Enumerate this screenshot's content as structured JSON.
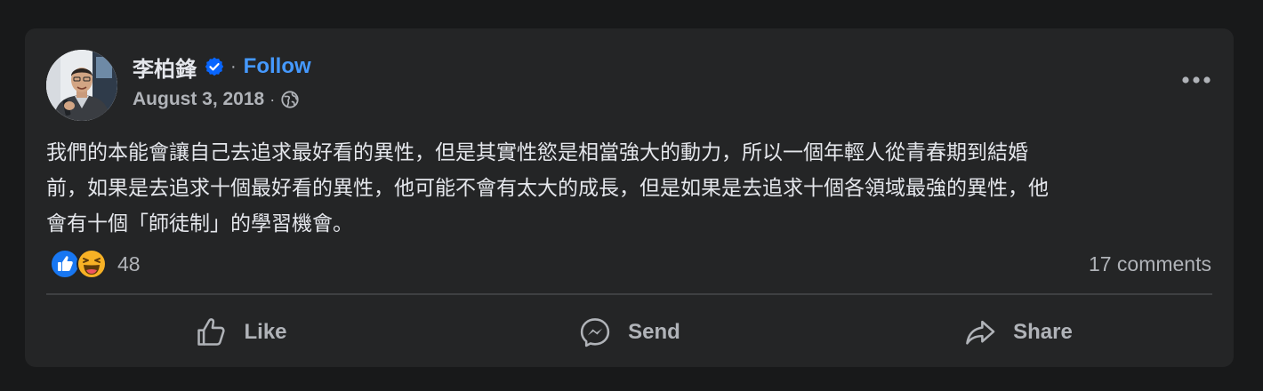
{
  "post": {
    "author": {
      "name": "李柏鋒",
      "verified": true,
      "follow_label": "Follow",
      "separator": "·",
      "avatar_icon": "profile-photo"
    },
    "date": "August 3, 2018",
    "meta_separator": "·",
    "privacy_icon": "globe-icon",
    "text": "我們的本能會讓自己去追求最好看的異性，但是其實性慾是相當強大的動力，所以一個年輕人從青春期到結婚\n前，如果是去追求十個最好看的異性，他可能不會有太大的成長，但是如果是去追求十個各領域最強的異性，他\n會有十個「師徒制」的學習機會。",
    "reactions": {
      "types": [
        "like",
        "haha"
      ],
      "count": "48"
    },
    "comments_label": "17 comments",
    "actions": [
      {
        "icon": "like-icon",
        "label": "Like"
      },
      {
        "icon": "messenger-icon",
        "label": "Send"
      },
      {
        "icon": "share-icon",
        "label": "Share"
      }
    ]
  },
  "colors": {
    "background": "#18191a",
    "card": "#242526",
    "primary_text": "#e4e6eb",
    "secondary_text": "#b0b3b8",
    "link": "#4599ff",
    "verified": "#0866ff",
    "divider": "#3e4042"
  }
}
